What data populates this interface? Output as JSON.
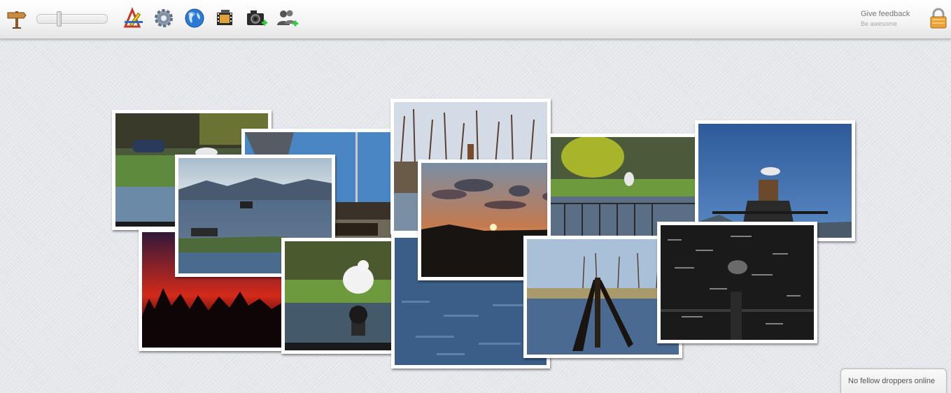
{
  "toolbar": {
    "icons": [
      "signpost-icon",
      "edit-tools-icon",
      "gear-icon",
      "globe-icon",
      "film-icon",
      "add-camera-icon",
      "add-users-icon"
    ],
    "feedback_title": "Give feedback",
    "feedback_sub": "Be awesome"
  },
  "status": {
    "online": "No fellow droppers online"
  },
  "colors": {
    "accent": "#3a78c4",
    "toolbar_bg": "#f3f3f3",
    "canvas_bg": "#e6e7ec"
  }
}
